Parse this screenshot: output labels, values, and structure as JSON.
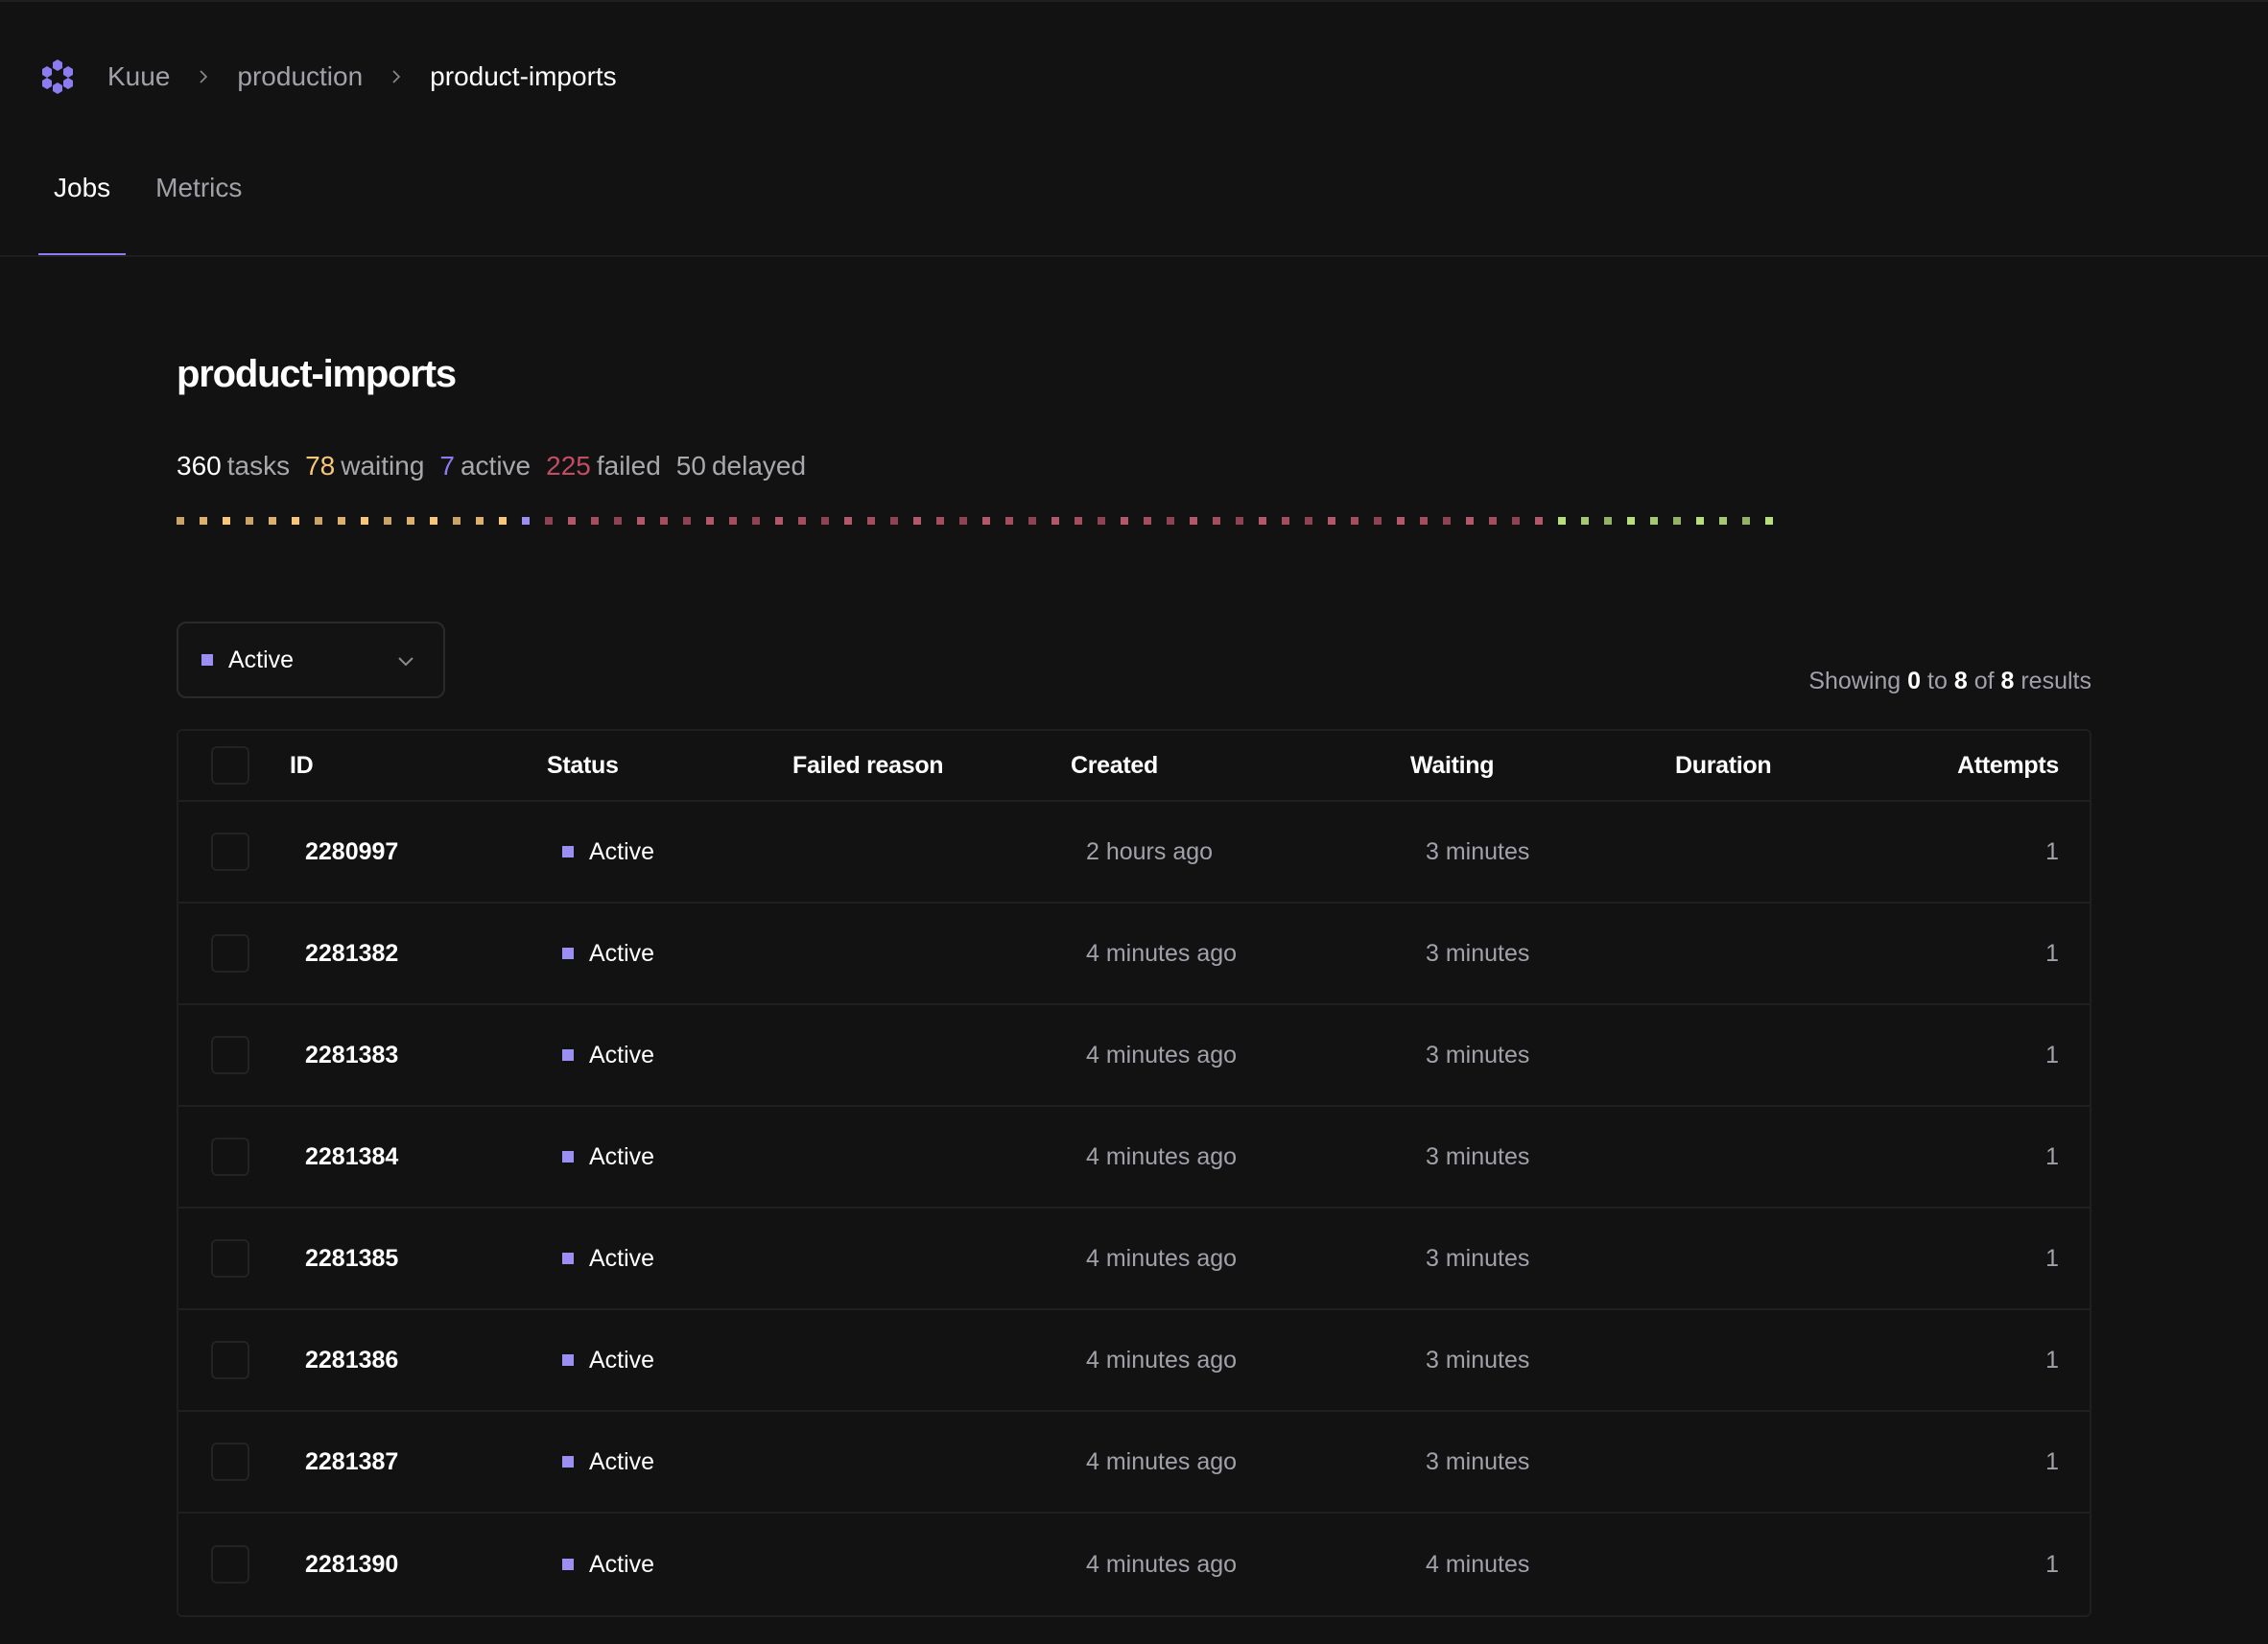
{
  "breadcrumb": {
    "logo_icon": "kuue-hexagon-logo-icon",
    "items": [
      "Kuue",
      "production",
      "product-imports"
    ]
  },
  "tabs": [
    {
      "label": "Jobs",
      "active": true
    },
    {
      "label": "Metrics",
      "active": false
    }
  ],
  "page": {
    "title": "product-imports",
    "stats": [
      {
        "value": "360",
        "label": "tasks",
        "color": "#ffffff"
      },
      {
        "value": "78",
        "label": "waiting",
        "color": "#f7c67a"
      },
      {
        "value": "7",
        "label": "active",
        "color": "#8b7cf0"
      },
      {
        "value": "225",
        "label": "failed",
        "color": "#c04d63"
      },
      {
        "value": "50",
        "label": "delayed",
        "color": "#a8a8ad"
      }
    ],
    "status_strip": {
      "segments": [
        {
          "status": "waiting",
          "count": 15,
          "colors": [
            "#c9a466",
            "#dcb06e",
            "#f7c67a"
          ]
        },
        {
          "status": "active",
          "count": 1,
          "colors": [
            "#9b8ff2"
          ]
        },
        {
          "status": "failed",
          "count": 44,
          "colors": [
            "#8e4254",
            "#b3586a",
            "#a34d5f"
          ]
        },
        {
          "status": "completed",
          "count": 10,
          "colors": [
            "#b6df7c",
            "#a5c874",
            "#93b268"
          ]
        }
      ]
    }
  },
  "filter": {
    "selected": "Active",
    "color": "#9b8ff2"
  },
  "pagination": {
    "prefix": "Showing",
    "from": "0",
    "to_word": "to",
    "to": "8",
    "of_word": "of",
    "total": "8",
    "suffix": "results"
  },
  "table": {
    "columns": [
      "ID",
      "Status",
      "Failed reason",
      "Created",
      "Waiting",
      "Duration",
      "Attempts"
    ],
    "rows": [
      {
        "id": "2280997",
        "status": "Active",
        "failed_reason": "",
        "created": "2 hours ago",
        "waiting": "3 minutes",
        "duration": "",
        "attempts": "1"
      },
      {
        "id": "2281382",
        "status": "Active",
        "failed_reason": "",
        "created": "4 minutes ago",
        "waiting": "3 minutes",
        "duration": "",
        "attempts": "1"
      },
      {
        "id": "2281383",
        "status": "Active",
        "failed_reason": "",
        "created": "4 minutes ago",
        "waiting": "3 minutes",
        "duration": "",
        "attempts": "1"
      },
      {
        "id": "2281384",
        "status": "Active",
        "failed_reason": "",
        "created": "4 minutes ago",
        "waiting": "3 minutes",
        "duration": "",
        "attempts": "1"
      },
      {
        "id": "2281385",
        "status": "Active",
        "failed_reason": "",
        "created": "4 minutes ago",
        "waiting": "3 minutes",
        "duration": "",
        "attempts": "1"
      },
      {
        "id": "2281386",
        "status": "Active",
        "failed_reason": "",
        "created": "4 minutes ago",
        "waiting": "3 minutes",
        "duration": "",
        "attempts": "1"
      },
      {
        "id": "2281387",
        "status": "Active",
        "failed_reason": "",
        "created": "4 minutes ago",
        "waiting": "3 minutes",
        "duration": "",
        "attempts": "1"
      },
      {
        "id": "2281390",
        "status": "Active",
        "failed_reason": "",
        "created": "4 minutes ago",
        "waiting": "4 minutes",
        "duration": "",
        "attempts": "1"
      }
    ]
  }
}
